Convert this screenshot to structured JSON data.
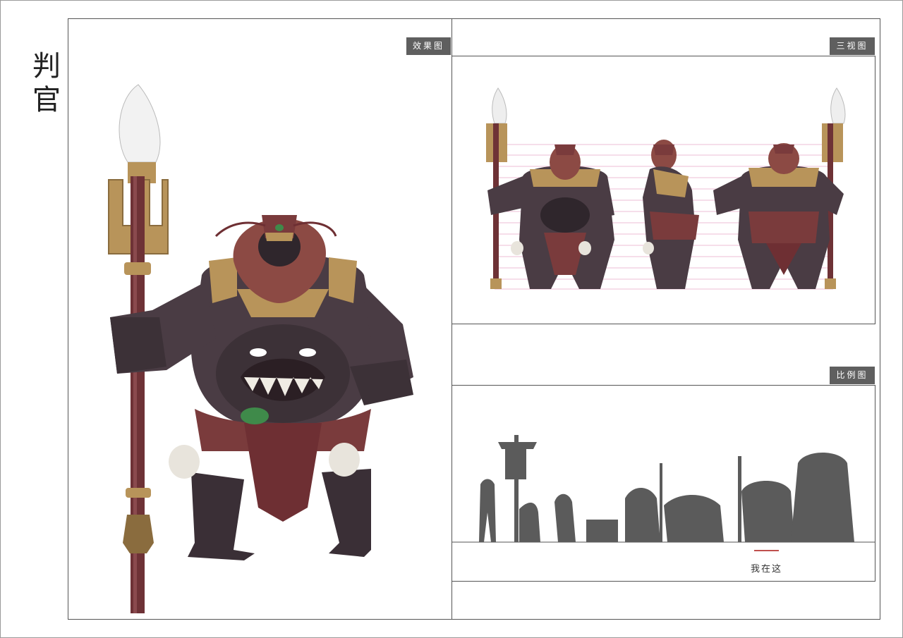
{
  "page": {
    "vertical_title": [
      "判",
      "官"
    ]
  },
  "main_illustration": {
    "tag": "效果图"
  },
  "turnaround": {
    "tag": "三视图"
  },
  "scale_comparison": {
    "tag": "比例图",
    "marker_caption": "我在这"
  },
  "colors": {
    "skin": "#4a3c44",
    "skin_shadow": "#2f262c",
    "gold": "#b8945a",
    "cloth_red": "#7a3b3c",
    "beard": "#8c4a44",
    "silhouette": "#5b5b5b",
    "tag_bg": "#5f5f5f",
    "guide_line": "#e7a8c8",
    "marker": "#c0504d"
  }
}
